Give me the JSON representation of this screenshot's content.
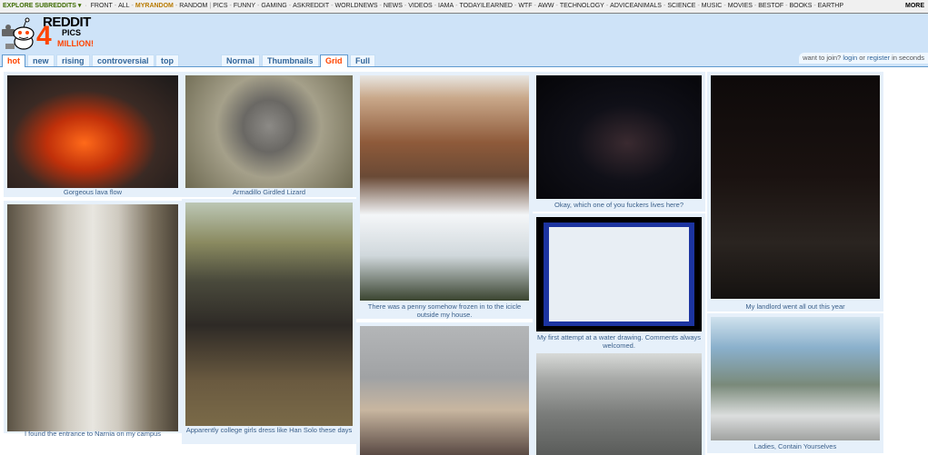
{
  "srbar": {
    "explore": "Explore subreddits",
    "items": [
      "FRONT",
      "ALL",
      "MYRANDOM",
      "RANDOM",
      "PICS",
      "FUNNY",
      "GAMING",
      "ASKREDDIT",
      "WORLDNEWS",
      "NEWS",
      "VIDEOS",
      "IAMA",
      "TODAYILEARNED",
      "WTF",
      "AWW",
      "TECHNOLOGY",
      "ADVICEANIMALS",
      "SCIENCE",
      "MUSIC",
      "MOVIES",
      "BESTOF",
      "BOOKS",
      "EARTHP"
    ],
    "more": "MORE"
  },
  "logo": {
    "word": "REDDIT",
    "sub": "PICS",
    "big": "4",
    "million": "MILLION!"
  },
  "sort_tabs": [
    "hot",
    "new",
    "rising",
    "controversial",
    "top"
  ],
  "view_tabs": [
    "Normal",
    "Thumbnails",
    "Grid",
    "Full"
  ],
  "login": {
    "prefix": "want to join?",
    "login": "login",
    "or": "or",
    "register": "register",
    "suffix": "in seconds"
  },
  "posts": [
    {
      "caption": "Gorgeous lava flow"
    },
    {
      "caption": "Armadillo Girdled Lizard"
    },
    {
      "caption": "There was a penny somehow frozen in to the icicle outside my house."
    },
    {
      "caption": "Okay, which one of you fuckers lives here?"
    },
    {
      "caption": "My landlord went all out this year"
    },
    {
      "caption": "I found the entrance to Narnia on my campus"
    },
    {
      "caption": "Apparently college girls dress like Han Solo these days"
    },
    {
      "caption": "My first attempt at a water drawing. Comments always welcomed."
    },
    {
      "caption": "Ladies, Contain Yourselves"
    }
  ],
  "colors": {
    "accent": "#ff4500",
    "header_bg": "#cee3f8",
    "link": "#336699"
  }
}
